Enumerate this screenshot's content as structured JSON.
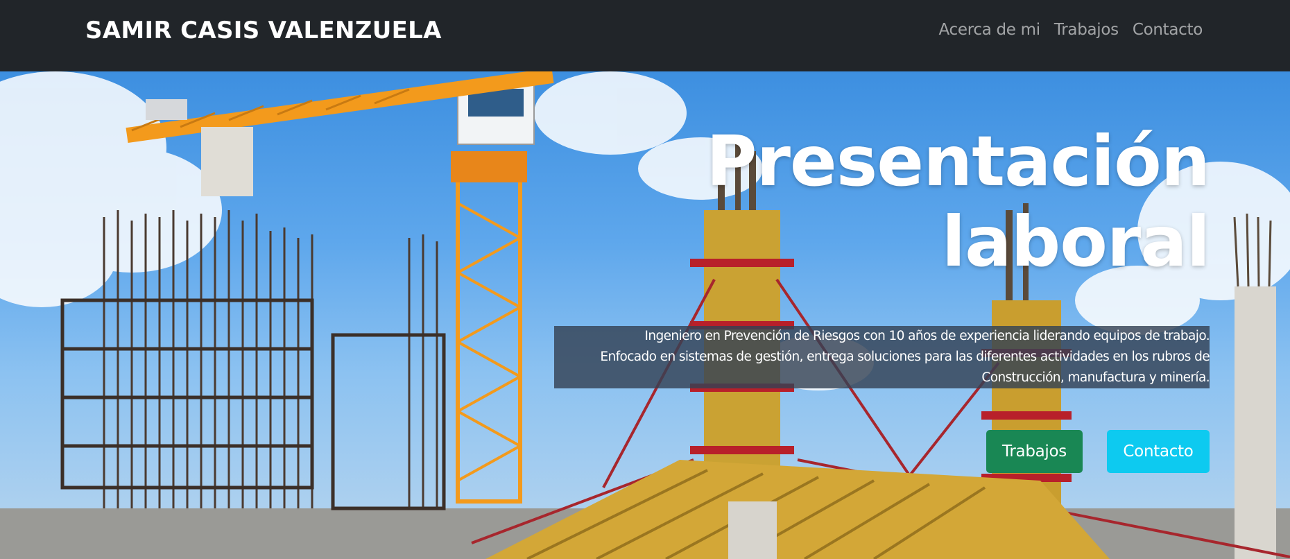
{
  "navbar": {
    "brand": "SAMIR CASIS VALENZUELA",
    "links": [
      "Acerca de mi",
      "Trabajos",
      "Contacto"
    ]
  },
  "hero": {
    "title_line1": "Presentación",
    "title_line2": "laboral",
    "description_line1": "Ingeniero en Prevención de Riesgos con 10 años de experiencia liderando equipos de trabajo.",
    "description_line2": "Enfocado en sistemas de gestión, entrega soluciones para las diferentes actividades en los rubros de",
    "description_line3": "Construcción, manufactura y minería.",
    "buttons": {
      "primary": "Trabajos",
      "secondary": "Contacto"
    },
    "background_image": "construction-site-crane-photo"
  },
  "colors": {
    "navbar_bg": "#212529",
    "btn_success": "#198754",
    "btn_info": "#0dcaf0",
    "desc_bg": "#344254"
  }
}
